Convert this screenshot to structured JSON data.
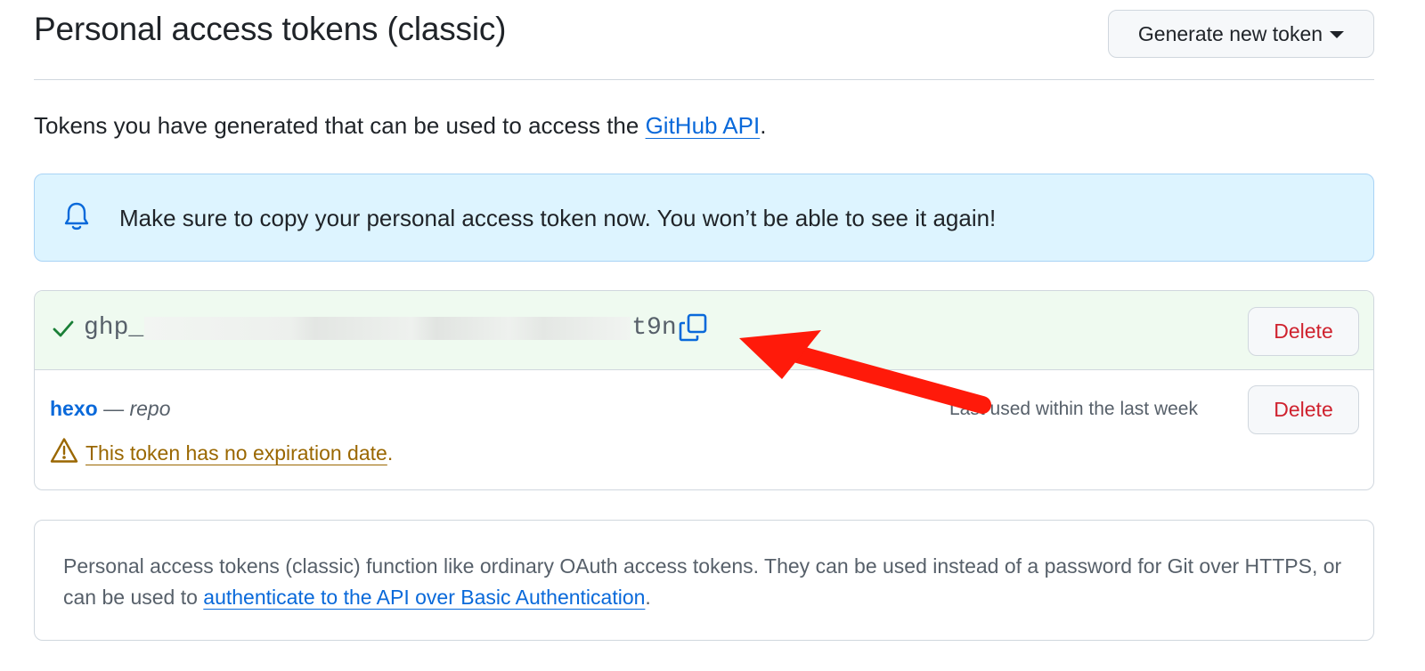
{
  "header": {
    "title": "Personal access tokens (classic)",
    "generate_button_label": "Generate new token"
  },
  "intro": {
    "text": "Tokens you have generated that can be used to access the ",
    "link_text": "GitHub API",
    "suffix": "."
  },
  "flash": {
    "icon": "bell-icon",
    "message": "Make sure to copy your personal access token now. You won’t be able to see it again!",
    "background_color": "#ddf4ff"
  },
  "new_token": {
    "prefix": "ghp_",
    "suffix": "t9n",
    "status_icon": "check-icon",
    "copy_icon": "copy-icon",
    "delete_label": "Delete"
  },
  "existing_token": {
    "name": "hexo",
    "separator": " — ",
    "scope": "repo",
    "last_used": "Last used within the last week",
    "delete_label": "Delete",
    "warning_text": "This token has no expiration date",
    "warning_suffix": ".",
    "warning_icon": "alert-icon"
  },
  "info": {
    "text": "Personal access tokens (classic) function like ordinary OAuth access tokens. They can be used instead of a password for Git over HTTPS, or can be used to ",
    "link_text": "authenticate to the API over Basic Authentication",
    "suffix": "."
  },
  "colors": {
    "link": "#0969da",
    "danger": "#cf222e",
    "warning": "#9a6700",
    "success": "#1a7f37",
    "annotation_arrow": "#ff1a0a"
  }
}
